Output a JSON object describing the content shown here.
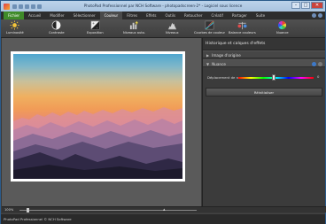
{
  "window": {
    "title": "PhotoPad Professionnel par NCH Software - photopadscreen-2* - Logiciel sous licence",
    "controls": [
      "minimize",
      "maximize",
      "close"
    ]
  },
  "menu": {
    "tabs": [
      "Fichier",
      "Accueil",
      "Modifier",
      "Sélectionner",
      "Couleur",
      "Filtres",
      "Effets",
      "Outils",
      "Retoucher",
      "Créatif",
      "Partager",
      "Suite"
    ],
    "active": "Couleur"
  },
  "ribbon": {
    "items": [
      {
        "label": "Luminosité",
        "icon": "sun-icon"
      },
      {
        "label": "Contraste",
        "icon": "contrast-icon"
      },
      {
        "label": "Exposition",
        "icon": "exposure-icon"
      },
      {
        "label": "Niveaux auto.",
        "icon": "auto-levels-icon"
      },
      {
        "label": "Niveaux",
        "icon": "levels-icon"
      },
      {
        "label": "Courbes de couleur",
        "icon": "curves-icon"
      },
      {
        "label": "Balance couleurs",
        "icon": "color-balance-icon"
      },
      {
        "label": "Nuance",
        "icon": "hue-wheel-icon"
      }
    ]
  },
  "canvas": {
    "zoom": "100%"
  },
  "panel": {
    "title": "Historique et calques d'effets",
    "sections": {
      "original": "Image d'origine",
      "nuance": "Nuance"
    },
    "hue_label": "Déplacement de nuance :",
    "hue_value": "0",
    "hue_fraction": 0.5,
    "reset_label": "Réinitialiser"
  },
  "status": {
    "text": "PhotoPad Professionnel © NCH Software"
  },
  "colors": {
    "accent": "#3f8b2a",
    "title_bar": "#a9c3df",
    "panel_bg": "#3b3b3b"
  }
}
